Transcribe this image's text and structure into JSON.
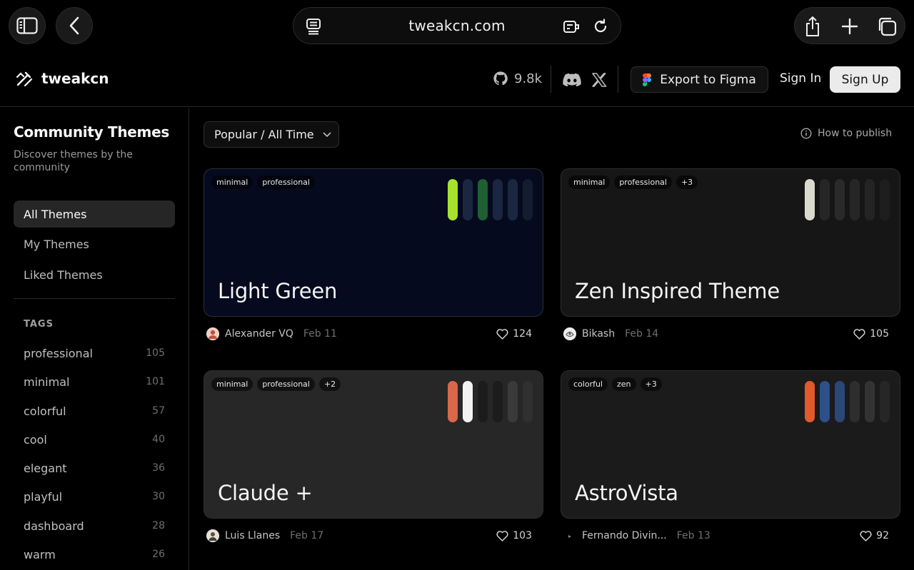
{
  "browser": {
    "url": "tweakcn.com"
  },
  "header": {
    "brand": "tweakcn",
    "github_stars": "9.8k",
    "export_label": "Export to Figma",
    "signin_label": "Sign In",
    "signup_label": "Sign Up"
  },
  "sidebar": {
    "title": "Community Themes",
    "subtitle": "Discover themes by the community",
    "nav": [
      {
        "label": "All Themes",
        "active": true
      },
      {
        "label": "My Themes",
        "active": false
      },
      {
        "label": "Liked Themes",
        "active": false
      }
    ],
    "tags_heading": "TAGS",
    "tags": [
      {
        "name": "professional",
        "count": "105"
      },
      {
        "name": "minimal",
        "count": "101"
      },
      {
        "name": "colorful",
        "count": "57"
      },
      {
        "name": "cool",
        "count": "40"
      },
      {
        "name": "elegant",
        "count": "36"
      },
      {
        "name": "playful",
        "count": "30"
      },
      {
        "name": "dashboard",
        "count": "28"
      },
      {
        "name": "warm",
        "count": "26"
      }
    ]
  },
  "main": {
    "sort_label": "Popular / All Time",
    "howto_label": "How to publish",
    "themes": [
      {
        "title": "Light Green",
        "tags": [
          "minimal",
          "professional"
        ],
        "bg": "#050a1f",
        "swatches": [
          "#a6e22e",
          "#1b2640",
          "#1f5f33",
          "#1b2640",
          "#1b2640",
          "#141c30"
        ],
        "author": "Alexander VQ",
        "date": "Feb 11",
        "likes": "124"
      },
      {
        "title": "Zen Inspired Theme",
        "tags": [
          "minimal",
          "professional",
          "+3"
        ],
        "bg": "#161616",
        "swatches": [
          "#d9d9cf",
          "#262626",
          "#2a2a2a",
          "#262626",
          "#242424",
          "#1e1e1e"
        ],
        "author": "Bikash",
        "date": "Feb 14",
        "likes": "105"
      },
      {
        "title": "Claude +",
        "tags": [
          "minimal",
          "professional",
          "+2"
        ],
        "bg": "#272727",
        "swatches": [
          "#d9674a",
          "#f2f2f2",
          "#1c1c1c",
          "#1c1c1c",
          "#3a3a3a",
          "#303030"
        ],
        "author": "Luis Llanes",
        "date": "Feb 17",
        "likes": "103"
      },
      {
        "title": "AstroVista",
        "tags": [
          "colorful",
          "zen",
          "+3"
        ],
        "bg": "#1b1b1b",
        "swatches": [
          "#e05a2b",
          "#2d4f8a",
          "#2a4778",
          "#2e2e2e",
          "#333333",
          "#262626"
        ],
        "author": "Fernando Divin...",
        "date": "Feb 13",
        "likes": "92"
      }
    ]
  }
}
